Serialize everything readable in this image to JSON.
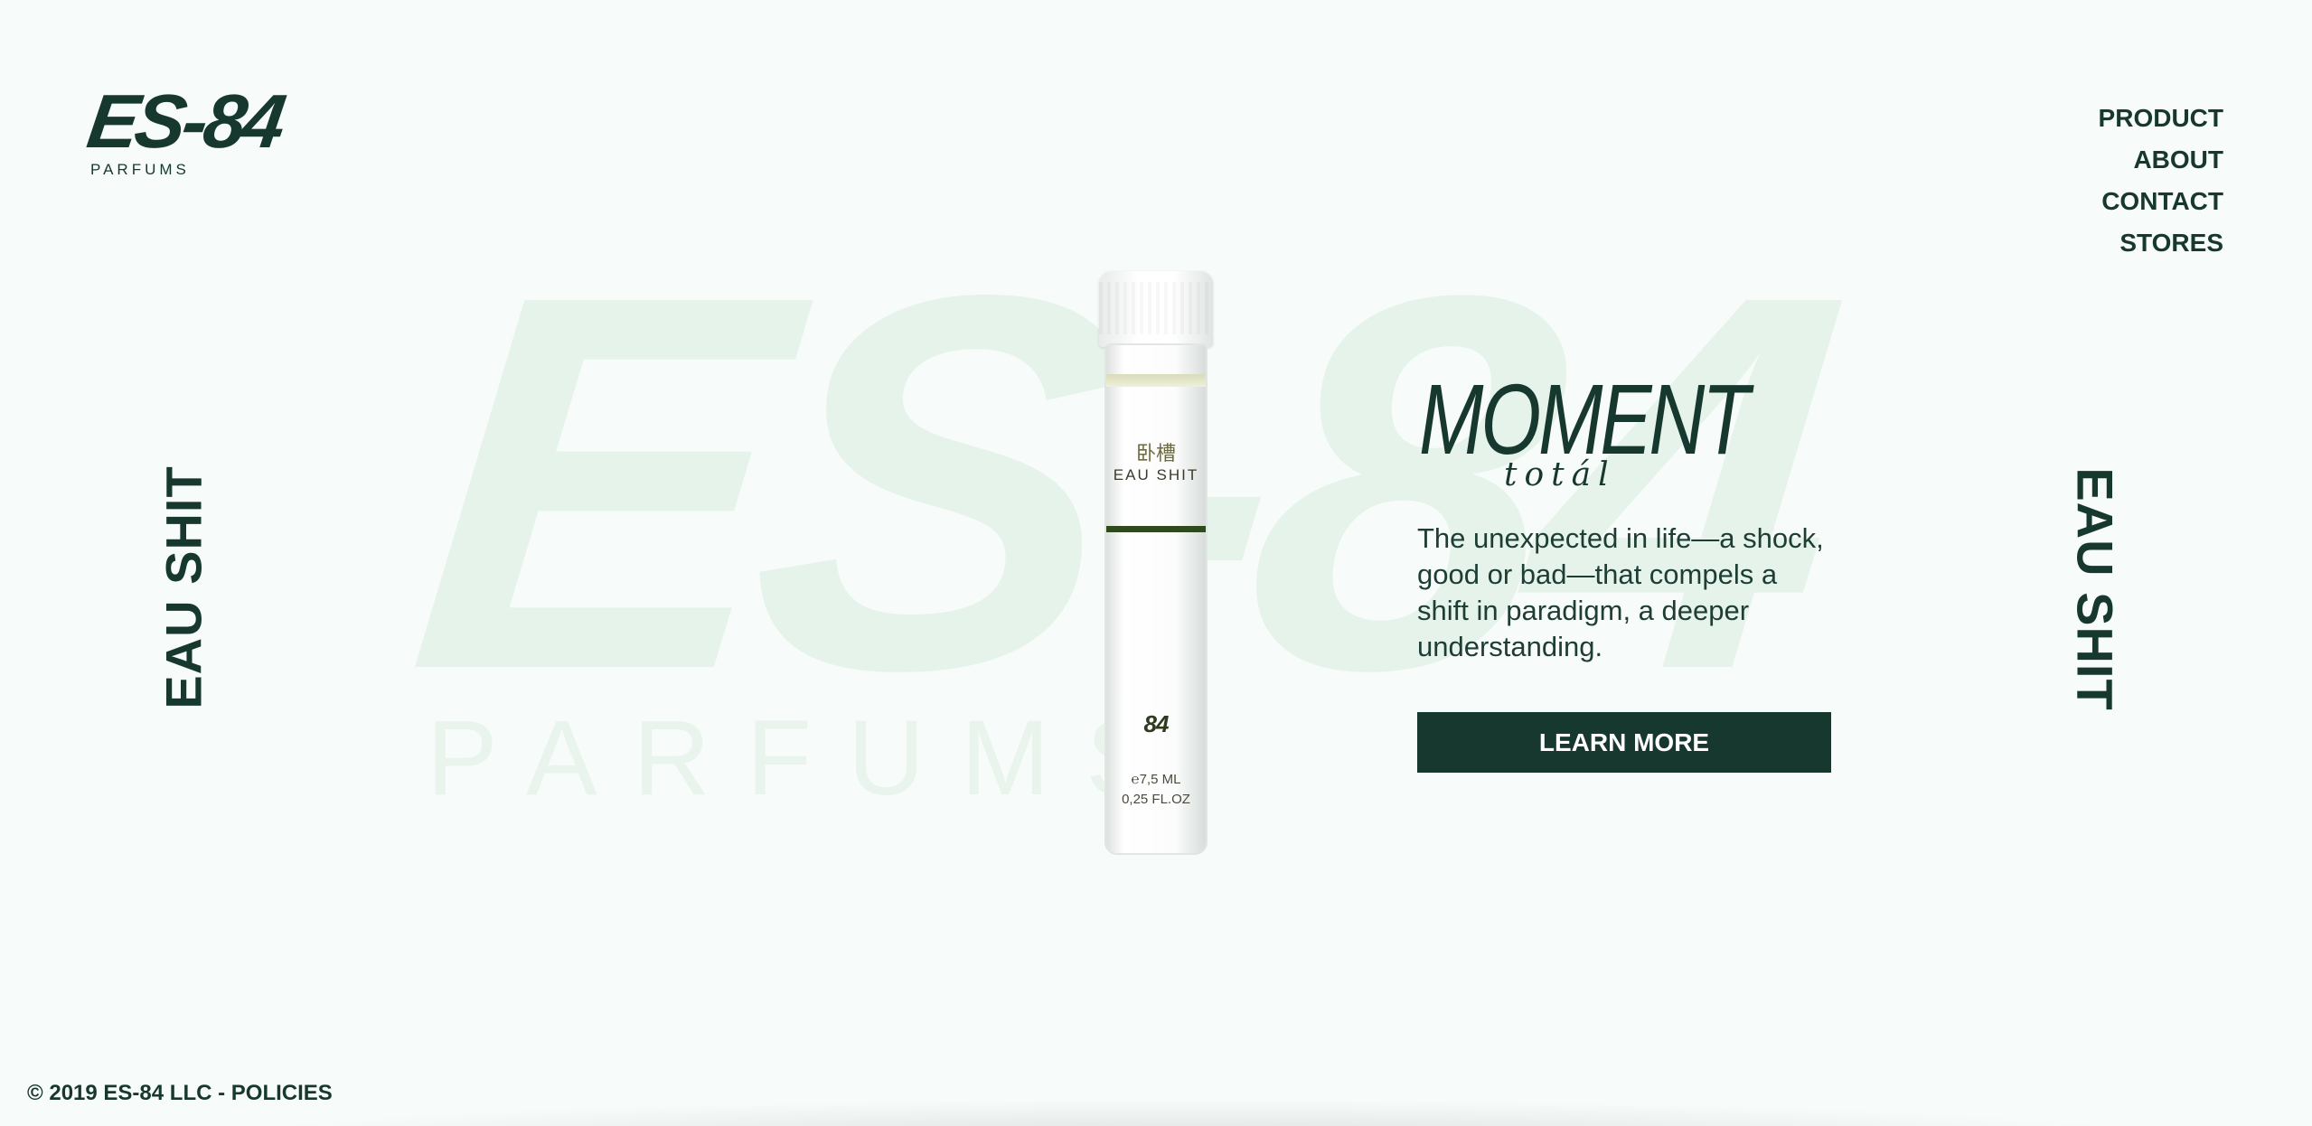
{
  "brand": {
    "logo_main": "ES-84",
    "logo_sub": "PARFUMS",
    "watermark_main": "ES-84",
    "watermark_sub": "PARFUMS"
  },
  "nav": {
    "items": [
      {
        "label": "PRODUCT"
      },
      {
        "label": "ABOUT"
      },
      {
        "label": "CONTACT"
      },
      {
        "label": "STORES"
      }
    ]
  },
  "side_text": {
    "left": "EAU SHIT",
    "right": "EAU SHIT"
  },
  "product": {
    "vial_cjk": "卧槽",
    "vial_label": "EAU SHIT",
    "vial_mark": "84",
    "vial_volume_ml": "℮7,5 ML",
    "vial_volume_oz": "0,25 FL.OZ",
    "title": "MOMENT",
    "subtitle": "totál",
    "description": "The unexpected in life—a shock, good or bad—that compels a shift in paradigm, a deeper understanding.",
    "cta_label": "LEARN MORE"
  },
  "footer": {
    "copyright": "© 2019 ES-84 LLC - ",
    "policies_label": "POLICIES"
  },
  "colors": {
    "background": "#f7fbf9",
    "primary": "#17382f",
    "watermark": "#e5f3ea"
  }
}
